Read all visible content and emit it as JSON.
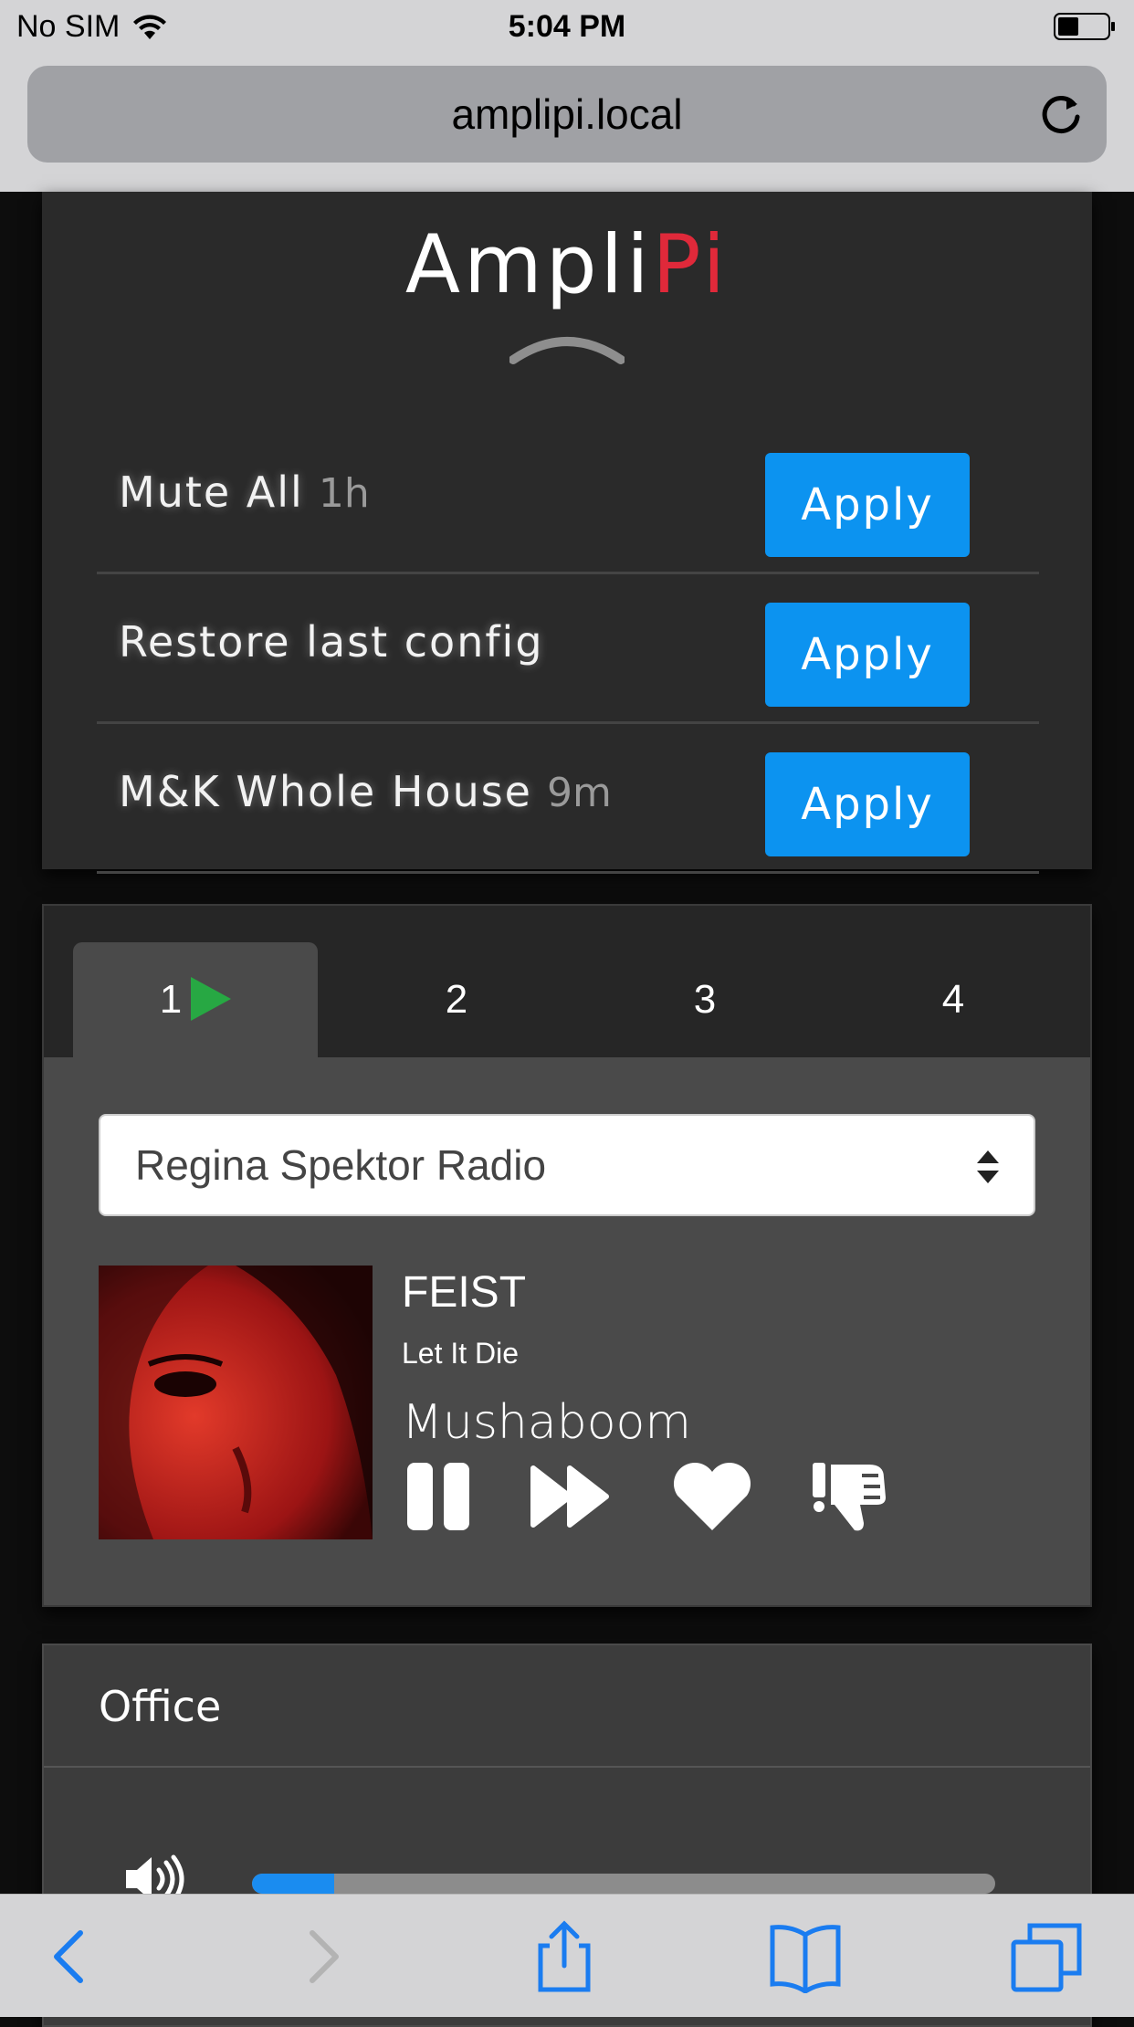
{
  "status_bar": {
    "carrier": "No SIM",
    "time": "5:04 PM"
  },
  "browser": {
    "url": "amplipi.local"
  },
  "brand": {
    "name_main": "Ampli",
    "name_accent": "Pi",
    "accent_color": "#e0293a"
  },
  "presets": [
    {
      "name": "Mute All",
      "age": "1h",
      "button": "Apply"
    },
    {
      "name": "Restore last config",
      "age": "",
      "button": "Apply"
    },
    {
      "name": "M&K Whole House",
      "age": "9m",
      "button": "Apply"
    }
  ],
  "source_tabs": [
    {
      "label": "1",
      "active": true,
      "playing": true
    },
    {
      "label": "2",
      "active": false
    },
    {
      "label": "3",
      "active": false
    },
    {
      "label": "4",
      "active": false
    }
  ],
  "source": {
    "selected_stream": "Regina Spektor Radio",
    "artist": "FEIST",
    "album": "Let It Die",
    "title": "Mushaboom",
    "controls": [
      "pause-icon",
      "next-icon",
      "like-icon",
      "dislike-icon"
    ]
  },
  "zone": {
    "name": "Office",
    "volume_fraction": 0.11
  },
  "colors": {
    "apply_button": "#0c93f0",
    "playing_indicator": "#27a843",
    "volume_fill": "#1a8cf0",
    "ios_blue": "#1a7cf0"
  }
}
